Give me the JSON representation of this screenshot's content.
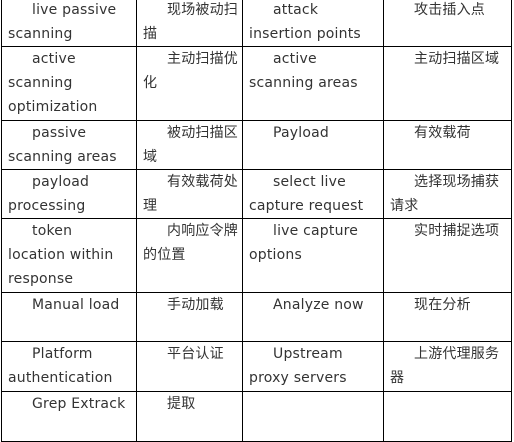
{
  "glossary": {
    "rows": [
      {
        "en1": "live passive scanning",
        "zh1": "现场被动扫描",
        "en2": "attack insertion points",
        "zh2": "攻击插入点"
      },
      {
        "en1": "active scanning optimization",
        "zh1": "主动扫描优化",
        "en2": "active scanning areas",
        "zh2": "主动扫描区域"
      },
      {
        "en1": "passive scanning areas",
        "zh1": "被动扫描区域",
        "en2": "Payload",
        "zh2": "有效载荷"
      },
      {
        "en1": "payload processing",
        "zh1": "有效载荷处理",
        "en2": "select live capture request",
        "zh2": "选择现场捕获请求"
      },
      {
        "en1": "token location within response",
        "zh1": "内响应令牌的位置",
        "en2": "live capture options",
        "zh2": "实时捕捉选项"
      },
      {
        "en1": "Manual load",
        "zh1": "手动加载",
        "en2": "Analyze now",
        "zh2": "现在分析"
      },
      {
        "en1": "Platform authentication",
        "zh1": "平台认证",
        "en2": "Upstream proxy servers",
        "zh2": "上游代理服务器"
      },
      {
        "en1": "Grep Extrack",
        "zh1": "提取",
        "en2": "",
        "zh2": ""
      }
    ]
  }
}
